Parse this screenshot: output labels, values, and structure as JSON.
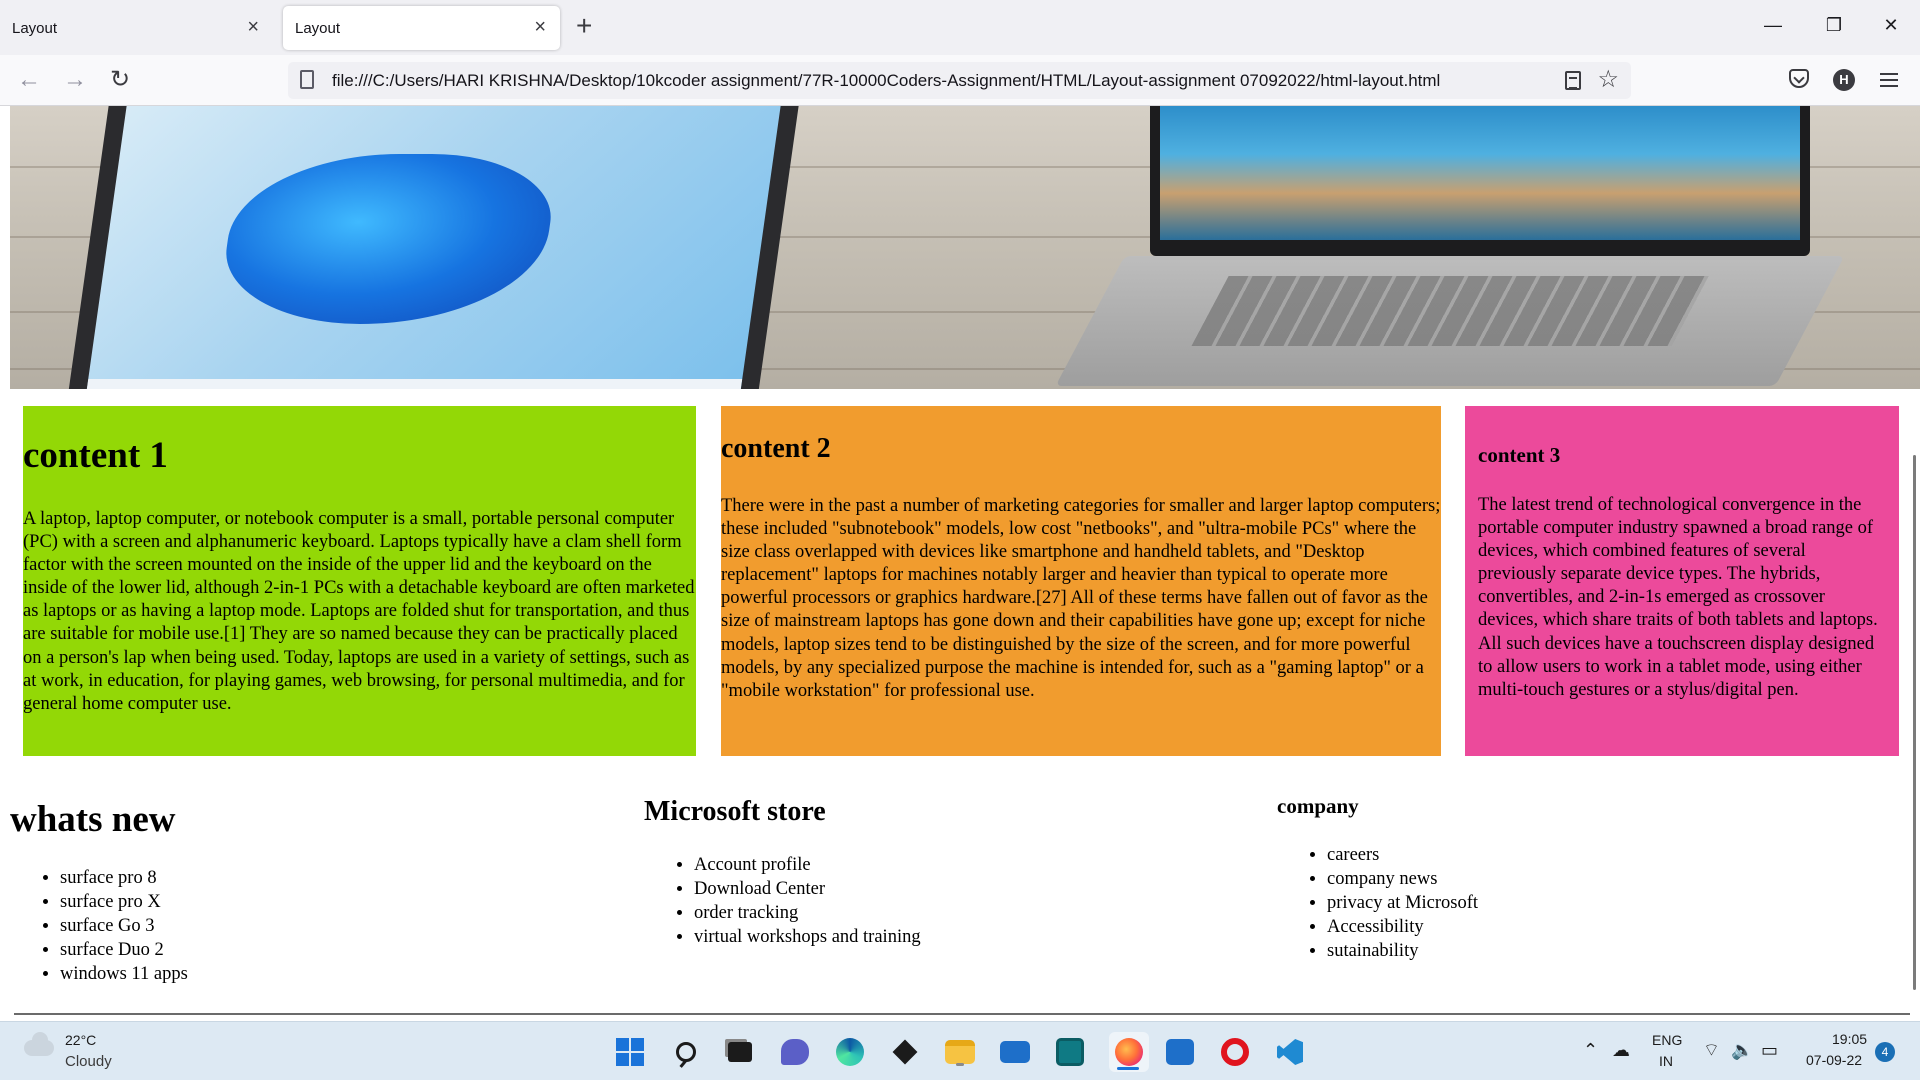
{
  "browser": {
    "tabs": [
      {
        "label": "Layout",
        "close": "×"
      },
      {
        "label": "Layout",
        "close": "×"
      }
    ],
    "new_tab": "+",
    "window_controls": {
      "minimize": "—",
      "restore": "❐",
      "close": "✕"
    },
    "nav": {
      "back": "←",
      "forward": "→",
      "reload": "↻"
    },
    "url": "file:///C:/Users/HARI KRISHNA/Desktop/10kcoder assignment/77R-10000Coders-Assignment/HTML/Layout-assignment 07092022/html-layout.html",
    "star": "☆",
    "account_initial": "H"
  },
  "content": [
    {
      "heading": "content 1",
      "text": "A laptop, laptop computer, or notebook computer is a small, portable personal computer (PC) with a screen and alphanumeric keyboard. Laptops typically have a clam shell form factor with the screen mounted on the inside of the upper lid and the keyboard on the inside of the lower lid, although 2-in-1 PCs with a detachable keyboard are often marketed as laptops or as having a laptop mode. Laptops are folded shut for transportation, and thus are suitable for mobile use.[1] They are so named because they can be practically placed on a person's lap when being used. Today, laptops are used in a variety of settings, such as at work, in education, for playing games, web browsing, for personal multimedia, and for general home computer use.",
      "color": "#93d806"
    },
    {
      "heading": "content 2",
      "text": "There were in the past a number of marketing categories for smaller and larger laptop computers; these included \"subnotebook\" models, low cost \"netbooks\", and \"ultra-mobile PCs\" where the size class overlapped with devices like smartphone and handheld tablets, and \"Desktop replacement\" laptops for machines notably larger and heavier than typical to operate more powerful processors or graphics hardware.[27] All of these terms have fallen out of favor as the size of mainstream laptops has gone down and their capabilities have gone up; except for niche models, laptop sizes tend to be distinguished by the size of the screen, and for more powerful models, by any specialized purpose the machine is intended for, such as a \"gaming laptop\" or a \"mobile workstation\" for professional use.",
      "color": "#f19c2e"
    },
    {
      "heading": "content 3",
      "text": "The latest trend of technological convergence in the portable computer industry spawned a broad range of devices, which combined features of several previously separate device types. The hybrids, convertibles, and 2-in-1s emerged as crossover devices, which share traits of both tablets and laptops. All such devices have a touchscreen display designed to allow users to work in a tablet mode, using either multi-touch gestures or a stylus/digital pen.",
      "color": "#ec4a9b"
    }
  ],
  "footer": [
    {
      "heading": "whats new",
      "items": [
        "surface pro 8",
        "surface pro X",
        "surface Go 3",
        "surface Duo 2",
        "windows 11 apps"
      ]
    },
    {
      "heading": "Microsoft store",
      "items": [
        "Account profile",
        "Download Center",
        "order tracking",
        "virtual workshops and training"
      ]
    },
    {
      "heading": "company",
      "items": [
        "careers",
        "company news",
        "privacy at Microsoft",
        "Accessibility",
        "sutainability"
      ]
    }
  ],
  "taskbar": {
    "weather_temp": "22°C",
    "weather_desc": "Cloudy",
    "apps": [
      "start-icon",
      "search-icon",
      "task-view-icon",
      "teams-chat-icon",
      "edge-icon",
      "dropbox-icon",
      "file-explorer-icon",
      "mail-icon",
      "app-icon",
      "firefox-icon",
      "store-icon",
      "opera-icon",
      "vscode-icon"
    ],
    "lang_line1": "ENG",
    "lang_line2": "IN",
    "time": "19:05",
    "date": "07-09-22",
    "notifications": "4"
  }
}
